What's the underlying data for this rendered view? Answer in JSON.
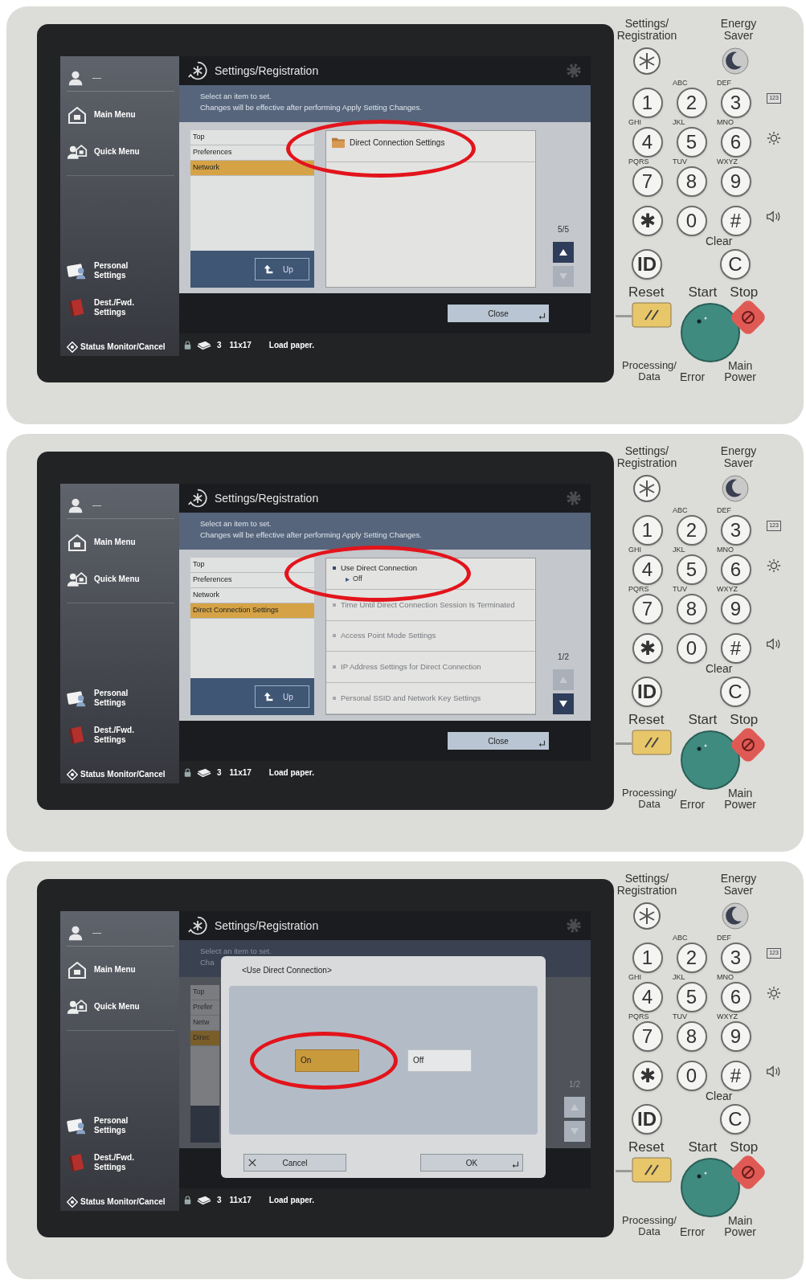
{
  "panels": [
    {
      "sidebar": {
        "user": "—",
        "items": [
          {
            "kind": "home",
            "label": "Main Menu"
          },
          {
            "kind": "quick",
            "label": "Quick Menu"
          },
          {
            "kind": "personal",
            "label": "Personal Settings"
          },
          {
            "kind": "destination",
            "label": "Dest./Fwd. Settings"
          }
        ],
        "status_button": "Status Monitor/Cancel"
      },
      "screen": {
        "title": "Settings/Registration",
        "instruction": [
          "Select an item to set.",
          "Changes will be effective after performing Apply Setting Changes."
        ],
        "breadcrumb": [
          {
            "label": "Top",
            "selected": false
          },
          {
            "label": "Preferences",
            "selected": false
          },
          {
            "label": "Network",
            "selected": true
          }
        ],
        "up_button": "Up",
        "items": [
          {
            "kind": "folder",
            "label": "Direct Connection Settings",
            "disabled": false,
            "circled": true
          }
        ],
        "page": "5/5",
        "scroll": {
          "up_enabled": true,
          "down_enabled": false
        },
        "close_button": "Close"
      },
      "status_bar": {
        "tray": "3",
        "paper_size": "11x17",
        "message": "Load paper."
      },
      "keypad": {
        "settings_label": "Settings/ Registration",
        "energy_label": "Energy Saver",
        "keys": [
          "1",
          "2",
          "3",
          "4",
          "5",
          "6",
          "7",
          "8",
          "9",
          "✱",
          "0",
          "#"
        ],
        "key_letters": [
          "ABC",
          "DEF",
          "GHI",
          "JKL",
          "MNO",
          "PQRS",
          "TUV",
          "WXYZ"
        ],
        "counter_label": "123",
        "clear_label": "Clear",
        "id_key": "ID",
        "clear_key": "C",
        "reset_label": "Reset",
        "start_label": "Start",
        "stop_label": "Stop",
        "processing_label": "Processing/ Data",
        "error_label": "Error",
        "power_label": "Main Power"
      }
    },
    {
      "sidebar": {
        "user": "—",
        "items": [
          {
            "kind": "home",
            "label": "Main Menu"
          },
          {
            "kind": "quick",
            "label": "Quick Menu"
          },
          {
            "kind": "personal",
            "label": "Personal Settings"
          },
          {
            "kind": "destination",
            "label": "Dest./Fwd. Settings"
          }
        ],
        "status_button": "Status Monitor/Cancel"
      },
      "screen": {
        "title": "Settings/Registration",
        "instruction": [
          "Select an item to set.",
          "Changes will be effective after performing Apply Setting Changes."
        ],
        "breadcrumb": [
          {
            "label": "Top",
            "selected": false
          },
          {
            "label": "Preferences",
            "selected": false
          },
          {
            "label": "Network",
            "selected": false
          },
          {
            "label": "Direct Connection Settings",
            "selected": true
          }
        ],
        "up_button": "Up",
        "items": [
          {
            "kind": "setting",
            "label": "Use Direct Connection",
            "value": "Off",
            "disabled": false,
            "circled": true
          },
          {
            "kind": "setting",
            "label": "Time Until Direct Connection Session Is Terminated",
            "disabled": true,
            "circled": false
          },
          {
            "kind": "setting",
            "label": "Access Point Mode Settings",
            "disabled": true,
            "circled": false
          },
          {
            "kind": "setting",
            "label": "IP Address Settings for Direct Connection",
            "disabled": true,
            "circled": false
          },
          {
            "kind": "setting",
            "label": "Personal SSID and Network Key Settings",
            "disabled": true,
            "circled": false
          }
        ],
        "page": "1/2",
        "scroll": {
          "up_enabled": false,
          "down_enabled": true
        },
        "close_button": "Close"
      },
      "status_bar": {
        "tray": "3",
        "paper_size": "11x17",
        "message": "Load paper."
      },
      "keypad": {
        "settings_label": "Settings/ Registration",
        "energy_label": "Energy Saver",
        "keys": [
          "1",
          "2",
          "3",
          "4",
          "5",
          "6",
          "7",
          "8",
          "9",
          "✱",
          "0",
          "#"
        ],
        "key_letters": [
          "ABC",
          "DEF",
          "GHI",
          "JKL",
          "MNO",
          "PQRS",
          "TUV",
          "WXYZ"
        ],
        "counter_label": "123",
        "clear_label": "Clear",
        "id_key": "ID",
        "clear_key": "C",
        "reset_label": "Reset",
        "start_label": "Start",
        "stop_label": "Stop",
        "processing_label": "Processing/ Data",
        "error_label": "Error",
        "power_label": "Main Power"
      }
    },
    {
      "sidebar": {
        "user": "—",
        "items": [
          {
            "kind": "home",
            "label": "Main Menu"
          },
          {
            "kind": "quick",
            "label": "Quick Menu"
          },
          {
            "kind": "personal",
            "label": "Personal Settings"
          },
          {
            "kind": "destination",
            "label": "Dest./Fwd. Settings"
          }
        ],
        "status_button": "Status Monitor/Cancel"
      },
      "screen": {
        "title": "Settings/Registration",
        "instruction": [
          "Select an item to set.",
          "Cha"
        ],
        "breadcrumb": [
          {
            "label": "Top",
            "selected": false
          },
          {
            "label": "Prefer",
            "selected": false
          },
          {
            "label": "Netw",
            "selected": false
          },
          {
            "label": "Direc",
            "selected": true
          }
        ],
        "page": "1/2",
        "scroll": {
          "up_enabled": false,
          "down_enabled": false
        },
        "dialog": {
          "title": "<Use Direct Connection>",
          "options": [
            {
              "label": "On",
              "selected": true,
              "circled": true
            },
            {
              "label": "Off",
              "selected": false,
              "circled": false
            }
          ],
          "cancel_button": "Cancel",
          "ok_button": "OK"
        }
      },
      "status_bar": {
        "tray": "3",
        "paper_size": "11x17",
        "message": "Load paper."
      },
      "keypad": {
        "settings_label": "Settings/ Registration",
        "energy_label": "Energy Saver",
        "keys": [
          "1",
          "2",
          "3",
          "4",
          "5",
          "6",
          "7",
          "8",
          "9",
          "✱",
          "0",
          "#"
        ],
        "key_letters": [
          "ABC",
          "DEF",
          "GHI",
          "JKL",
          "MNO",
          "PQRS",
          "TUV",
          "WXYZ"
        ],
        "counter_label": "123",
        "clear_label": "Clear",
        "id_key": "ID",
        "clear_key": "C",
        "reset_label": "Reset",
        "start_label": "Start",
        "stop_label": "Stop",
        "processing_label": "Processing/ Data",
        "error_label": "Error",
        "power_label": "Main Power"
      }
    }
  ]
}
